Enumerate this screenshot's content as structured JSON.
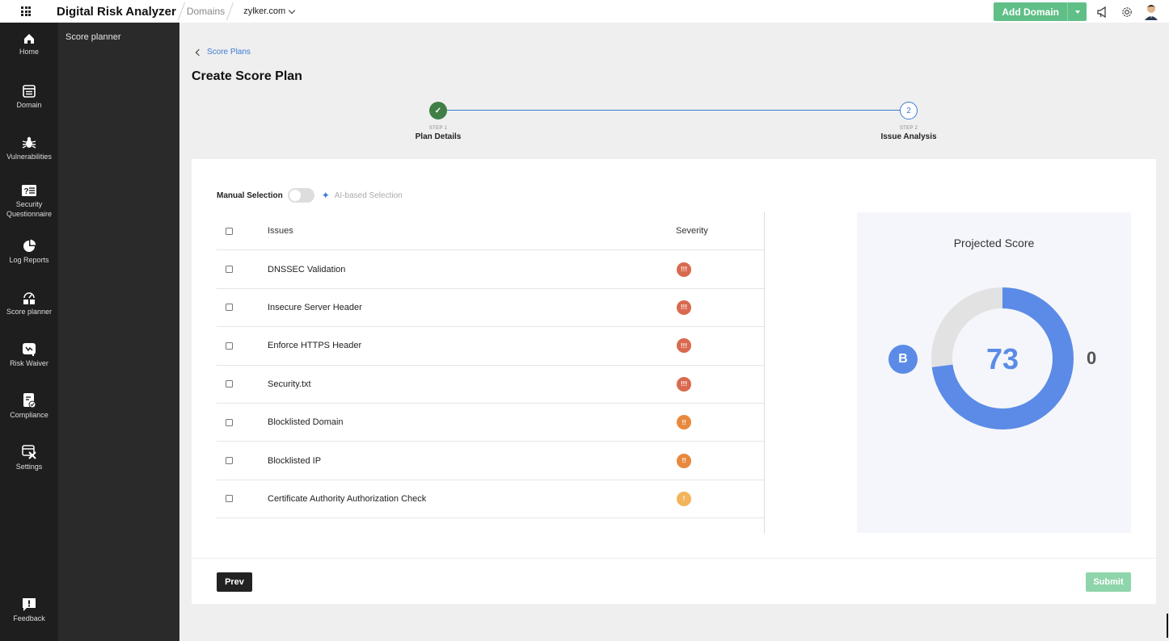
{
  "app": {
    "brand": "Digital Risk Analyzer"
  },
  "topbar": {
    "breadcrumb_domains": "Domains",
    "selected_domain": "zylker.com",
    "add_domain_label": "Add Domain"
  },
  "sidebar": {
    "items": [
      {
        "label": "Home",
        "icon": "home-icon"
      },
      {
        "label": "Domain",
        "icon": "domain-icon"
      },
      {
        "label": "Vulnerabilities",
        "icon": "bug-icon"
      },
      {
        "label": "Security Questionnaire",
        "icon": "questionnaire-icon"
      },
      {
        "label": "Log Reports",
        "icon": "pie-chart-icon"
      },
      {
        "label": "Score planner",
        "icon": "score-planner-icon"
      },
      {
        "label": "Risk Waiver",
        "icon": "risk-waiver-icon"
      },
      {
        "label": "Compliance",
        "icon": "compliance-icon"
      },
      {
        "label": "Settings",
        "icon": "settings-icon"
      }
    ],
    "feedback_label": "Feedback"
  },
  "subpanel": {
    "title": "Score planner"
  },
  "main": {
    "back_label": "Score Plans",
    "title": "Create Score Plan",
    "steps": [
      {
        "num": "STEP 1",
        "name": "Plan Details",
        "status": "done"
      },
      {
        "num": "STEP 2",
        "name": "Issue Analysis",
        "status": "active",
        "marker": "2"
      }
    ],
    "selection": {
      "manual_label": "Manual Selection",
      "ai_label": "AI-based Selection",
      "ai_enabled": false
    },
    "table": {
      "headers": {
        "issues": "Issues",
        "severity": "Severity"
      },
      "rows": [
        {
          "issue": "DNSSEC Validation",
          "severity": "high",
          "glyph": "!!!",
          "color": "#d9694f"
        },
        {
          "issue": "Insecure Server Header",
          "severity": "high",
          "glyph": "!!!",
          "color": "#d9694f"
        },
        {
          "issue": "Enforce HTTPS Header",
          "severity": "high",
          "glyph": "!!!",
          "color": "#d9694f"
        },
        {
          "issue": "Security.txt",
          "severity": "high",
          "glyph": "!!!",
          "color": "#d9694f"
        },
        {
          "issue": "Blocklisted Domain",
          "severity": "medium",
          "glyph": "!!",
          "color": "#e8893e"
        },
        {
          "issue": "Blocklisted IP",
          "severity": "medium",
          "glyph": "!!",
          "color": "#e8893e"
        },
        {
          "issue": "Certificate Authority Authorization Check",
          "severity": "low",
          "glyph": "!",
          "color": "#f2b55a"
        }
      ]
    },
    "projected": {
      "title": "Projected Score",
      "grade": "B",
      "score": "73",
      "gain": "0",
      "score_fraction": 0.73,
      "colors": {
        "fill": "#5b8be6",
        "track": "#e2e2e2",
        "grade": "#5b8be6"
      }
    },
    "buttons": {
      "prev": "Prev",
      "submit": "Submit"
    }
  }
}
